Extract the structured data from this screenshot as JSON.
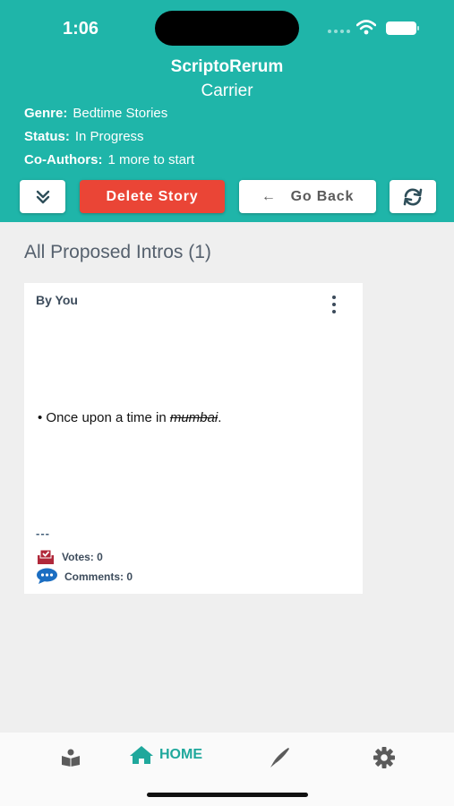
{
  "status_bar": {
    "time": "1:06"
  },
  "header": {
    "title": "ScriptoRerum",
    "subtitle": "Carrier",
    "genre_label": "Genre:",
    "genre_value": "Bedtime Stories",
    "status_label": "Status:",
    "status_value": "In Progress",
    "coauthors_label": "Co-Authors:",
    "coauthors_value": "1 more to start"
  },
  "toolbar": {
    "collapse_icon": "double-chevron-down-icon",
    "delete_label": "Delete Story",
    "back_arrow": "←",
    "back_label": "Go Back",
    "refresh_icon": "refresh-icon"
  },
  "main": {
    "section_title": "All Proposed Intros (1)",
    "cards": [
      {
        "author": "By You",
        "intro_prefix": "• Once upon a time in ",
        "intro_struck": "mumbai",
        "intro_suffix": ".",
        "divider": "---",
        "votes_label": "Votes: 0",
        "comments_label": "Comments: 0"
      }
    ]
  },
  "tabbar": {
    "items": [
      {
        "icon": "book-reader-icon"
      },
      {
        "icon": "home-icon",
        "label": "HOME",
        "active": true
      },
      {
        "icon": "pen-icon"
      },
      {
        "icon": "gear-icon"
      }
    ]
  },
  "colors": {
    "header": "#1fb5a9",
    "delete": "#ea4536",
    "accent": "#1fa89c",
    "votes_icon": "#b0283a",
    "comments_icon": "#1b6ec2"
  }
}
